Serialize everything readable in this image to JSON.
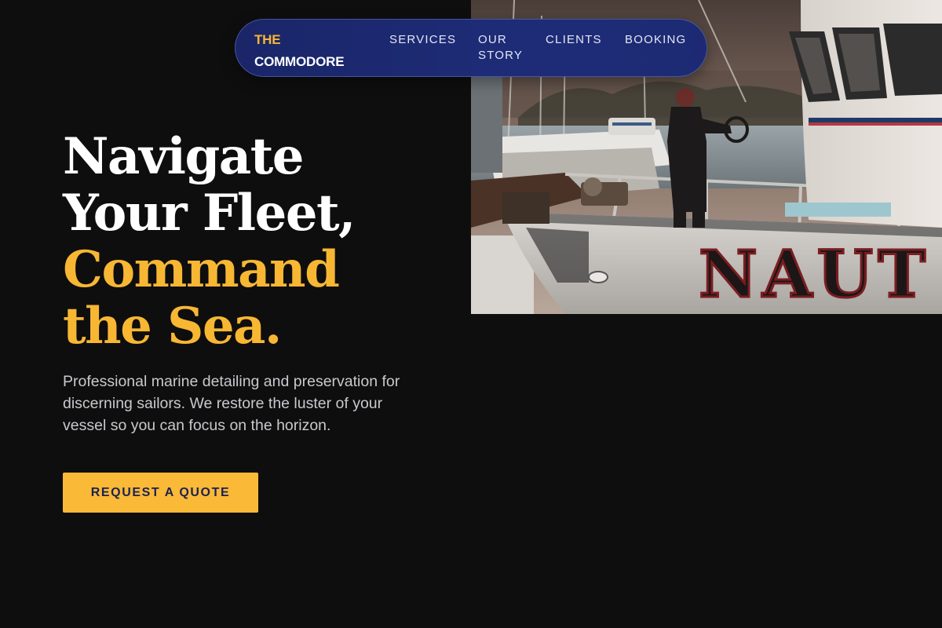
{
  "brand": {
    "line1": "THE",
    "line2": "COMMODORE"
  },
  "nav": {
    "items": [
      {
        "label": "SERVICES"
      },
      {
        "label": "OUR STORY"
      },
      {
        "label": "CLIENTS"
      },
      {
        "label": "BOOKING"
      }
    ]
  },
  "hero": {
    "headline": {
      "line1": "Navigate",
      "line2": "Your Fleet,",
      "line3": "Command",
      "line4": "the Sea."
    },
    "description": "Professional marine detailing and preservation for discerning sailors. We restore the luster of your vessel so you can focus on the horizon.",
    "cta_label": "REQUEST A QUOTE",
    "image": {
      "hull_lettering": "NAUT"
    }
  },
  "colors": {
    "background": "#0f0e0f",
    "accent": "#f7b733",
    "nav_background": "#1e2c78",
    "cta_text": "#1b2250"
  },
  "icons": []
}
